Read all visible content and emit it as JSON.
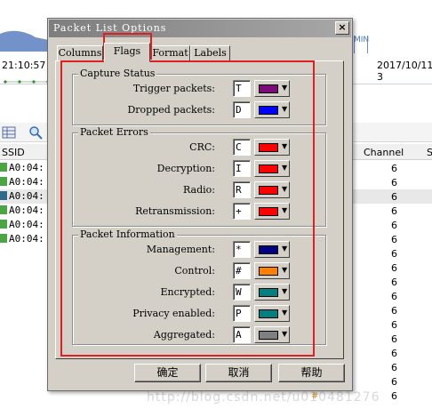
{
  "background": {
    "time_left": "21:10:57",
    "date_right": "2017/10/11 3",
    "min_label": "MIN",
    "columns": {
      "ssid": "SSID",
      "channel": "Channel",
      "extra": "S"
    },
    "rows": [
      {
        "ssid": "A0:04:",
        "channel": "6"
      },
      {
        "ssid": "A0:04:",
        "channel": "6"
      },
      {
        "ssid": "A0:04:",
        "channel": "6"
      },
      {
        "ssid": "A0:04:",
        "channel": "6"
      },
      {
        "ssid": "A0:04:",
        "channel": "6"
      },
      {
        "ssid": "A0:04:",
        "channel": "6"
      },
      {
        "ssid": "",
        "channel": "6"
      },
      {
        "ssid": "",
        "channel": "6"
      },
      {
        "ssid": "",
        "channel": "6"
      },
      {
        "ssid": "",
        "channel": "6"
      },
      {
        "ssid": "",
        "channel": "6"
      },
      {
        "ssid": "",
        "channel": "6"
      },
      {
        "ssid": "",
        "channel": "6"
      },
      {
        "ssid": "",
        "channel": "6"
      },
      {
        "ssid": "",
        "channel": "6"
      },
      {
        "ssid": "",
        "channel": "6"
      },
      {
        "ssid": "",
        "channel": "6"
      }
    ],
    "watermark": "http://blog.csdn.net/u010481276"
  },
  "dialog": {
    "title": "Packet List Options",
    "close_label": "×",
    "tabs": [
      "Columns",
      "Flags",
      "Format",
      "Labels"
    ],
    "active_tab": "Flags",
    "groups": [
      {
        "title": "Capture Status",
        "items": [
          {
            "label": "Trigger packets:",
            "value": "T",
            "color": "#7b0d7b"
          },
          {
            "label": "Dropped packets:",
            "value": "D",
            "color": "#0000ff"
          }
        ]
      },
      {
        "title": "Packet Errors",
        "items": [
          {
            "label": "CRC:",
            "value": "C",
            "color": "#ff0000"
          },
          {
            "label": "Decryption:",
            "value": "I",
            "color": "#ff0000"
          },
          {
            "label": "Radio:",
            "value": "R",
            "color": "#ff0000"
          },
          {
            "label": "Retransmission:",
            "value": "+",
            "color": "#ff0000"
          }
        ]
      },
      {
        "title": "Packet Information",
        "items": [
          {
            "label": "Management:",
            "value": "*",
            "color": "#000080"
          },
          {
            "label": "Control:",
            "value": "#",
            "color": "#ff8000"
          },
          {
            "label": "Encrypted:",
            "value": "W",
            "color": "#008080"
          },
          {
            "label": "Privacy enabled:",
            "value": "P",
            "color": "#008080"
          },
          {
            "label": "Aggregated:",
            "value": "A",
            "color": "#808080"
          }
        ]
      }
    ],
    "buttons": {
      "ok": "确定",
      "cancel": "取消",
      "help": "帮助"
    }
  },
  "annotation_color": "#e02020"
}
